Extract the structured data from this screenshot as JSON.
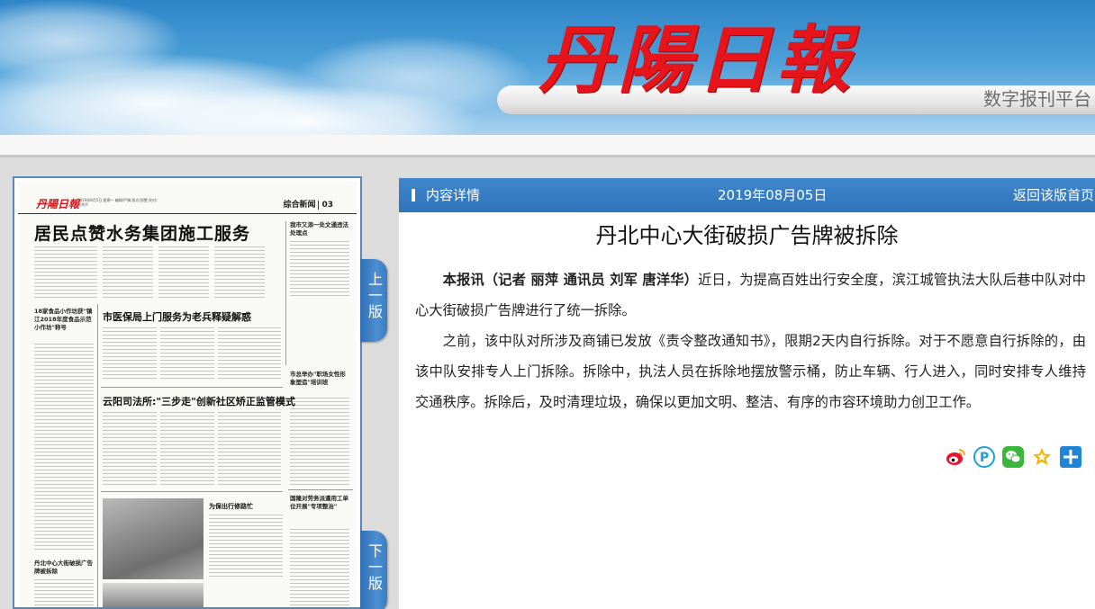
{
  "header": {
    "logo_text": "丹陽日報",
    "platform_label": "数字报刊平台"
  },
  "paper_page": {
    "logo": "丹陽日報",
    "dateline": "2019年8月5日 星期一 编辑/严娟 版式/邵雯 校对/吴秀平",
    "section_name": "综合新闻",
    "section_number": "03",
    "headline": "居民点赞水务集团施工服务",
    "side_head": "我市又添一处文通违法处理点",
    "sub_heads": [
      "市医保局上门服务为老兵释疑解惑",
      "云阳司法所:\"三步走\"创新社区矫正监管模式",
      "为保出行修路忙"
    ],
    "briefs": [
      "18家食品小作坊获\"镇江2018年度食品示范小作坊\"称号",
      "市总举办\"职场女性形象塑造\"培训班",
      "国隆对劳务派遣用工单位开展\"专项整治\"",
      "丹北中心大街破损广告牌被拆除"
    ]
  },
  "nav": {
    "prev_label": "上一版",
    "next_label": "下一版"
  },
  "article": {
    "bar_label": "内容详情",
    "date": "2019年08月05日",
    "back_label": "返回该版首页",
    "title": "丹北中心大街破损广告牌被拆除",
    "lead": "本报讯（记者 丽萍 通讯员 刘军 唐洋华）",
    "paragraph1": "近日，为提高百姓出行安全度，滨江城管执法大队后巷中队对中心大街破损广告牌进行了统一拆除。",
    "paragraph2": "之前，该中队对所涉及商铺已发放《责令整改通知书》，限期2天内自行拆除。对于不愿意自行拆除的，由该中队安排专人上门拆除。拆除中，执法人员在拆除地摆放警示桶，防止车辆、行人进入，同时安排专人维持交通秩序。拆除后，及时清理垃圾，确保以更加文明、整洁、有序的市容环境助力创卫工作。"
  },
  "share_icons": [
    "weibo-icon",
    "pinterest-icon",
    "wechat-icon",
    "favorite-star-icon",
    "more-plus-icon"
  ],
  "colors": {
    "bar_blue": "#2f74ba",
    "logo_red": "#e6141b",
    "tab_blue": "#3b7cc2"
  }
}
